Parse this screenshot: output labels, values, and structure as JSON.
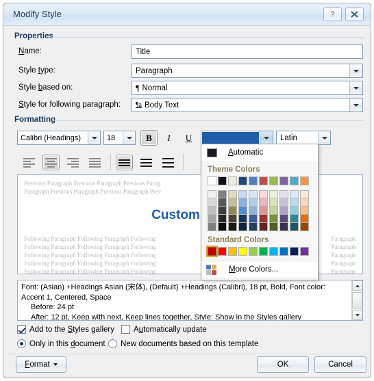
{
  "window": {
    "title": "Modify Style",
    "help_label": "?",
    "close_label": "✕"
  },
  "groups": {
    "properties": "Properties",
    "formatting": "Formatting"
  },
  "properties": {
    "name_label": "Name:",
    "name_value": "Title",
    "style_type_label": "Style type:",
    "style_type_value": "Paragraph",
    "style_based_on_label": "Style based on:",
    "style_based_on_value": "Normal",
    "style_based_on_icon": "pilcrow-icon",
    "style_following_label": "Style for following paragraph:",
    "style_following_value": "Body Text",
    "style_following_icon": "pilcrow-a-icon"
  },
  "formatting": {
    "font_family": "Calibri (Headings)",
    "font_size": "18",
    "bold_label": "B",
    "italic_label": "I",
    "underline_label": "U",
    "bold_active": true,
    "script_value": "Latin",
    "font_color": "#1f5fa9",
    "align_buttons": [
      "align-left",
      "align-center",
      "align-right",
      "align-justify"
    ],
    "align_selected": "align-center",
    "spacing_buttons": [
      "line-spacing-single",
      "line-spacing-1-5",
      "line-spacing-double"
    ],
    "spacing_selected": "line-spacing-single"
  },
  "color_menu": {
    "automatic_label": "Automatic",
    "automatic_swatch": "#151a22",
    "theme_header": "Theme Colors",
    "standard_header": "Standard Colors",
    "more_colors_label": "More Colors...",
    "theme_top_row": [
      "#ffffff",
      "#0d0f19",
      "#eeece1",
      "#1f497d",
      "#4f81bd",
      "#c0504d",
      "#9bbb59",
      "#8064a2",
      "#4bacc6",
      "#f79646"
    ],
    "theme_variants": [
      [
        "#f2f2f2",
        "#808080",
        "#ddd9c3",
        "#c6d9f0",
        "#dbe5f1",
        "#f2dcdb",
        "#ebf1dd",
        "#e5e0ec",
        "#dbeef3",
        "#fdeada"
      ],
      [
        "#d8d8d8",
        "#595959",
        "#c4bd97",
        "#8db3e2",
        "#b8cce4",
        "#e5b9b7",
        "#d7e3bc",
        "#ccc1d9",
        "#b7dde8",
        "#fbd5b5"
      ],
      [
        "#bfbfbf",
        "#3f3f3f",
        "#938953",
        "#548dd4",
        "#95b3d7",
        "#d99694",
        "#c3d69b",
        "#b2a2c7",
        "#92cddc",
        "#fac08f"
      ],
      [
        "#a5a5a5",
        "#262626",
        "#494429",
        "#17365d",
        "#366092",
        "#953734",
        "#76923c",
        "#5f497a",
        "#31859b",
        "#e36c09"
      ],
      [
        "#7f7f7f",
        "#0c0c0c",
        "#1d1b10",
        "#0f243e",
        "#244061",
        "#632423",
        "#4f6128",
        "#3f3151",
        "#205867",
        "#974806"
      ]
    ],
    "standard_colors": [
      "#c00000",
      "#ff0000",
      "#ffc000",
      "#ffff00",
      "#92d050",
      "#00b050",
      "#00b0f0",
      "#0070c0",
      "#002060",
      "#7030a0"
    ],
    "selected_standard_index": 0
  },
  "preview": {
    "previous_lines": [
      "Previous Paragraph Previous Paragraph Previous Parag",
      "Paragraph Previous Paragraph Previous Paragraph Prev"
    ],
    "sample_text": "Custom Wor",
    "following_lines": [
      "Following Paragraph Following Paragraph Following",
      "Following Paragraph Following Paragraph Following",
      "Following Paragraph Following Paragraph Following",
      "Following Paragraph Following Paragraph Following",
      "Following Paragraph Following Paragraph Following"
    ],
    "following_right": [
      "Paragraph",
      "Paragraph",
      "Paragraph",
      "Paragraph",
      "Paragraph"
    ]
  },
  "description": {
    "line1": "Font: (Asian) +Headings Asian (宋体), (Default) +Headings (Calibri), 18 pt, Bold, Font color:",
    "line2": "Accent 1, Centered, Space",
    "line3": "Before:  24 pt",
    "line4": "After:  12 pt, Keep with next, Keep lines together, Style: Show in the Styles gallery"
  },
  "options": {
    "add_to_gallery_label": "Add to the Styles gallery",
    "add_to_gallery_checked": true,
    "auto_update_label": "Automatically update",
    "auto_update_checked": false,
    "only_document_label": "Only in this document",
    "only_document_selected": true,
    "new_documents_label": "New documents based on this template",
    "new_documents_selected": false
  },
  "footer": {
    "format_label": "Format",
    "ok_label": "OK",
    "cancel_label": "Cancel"
  }
}
